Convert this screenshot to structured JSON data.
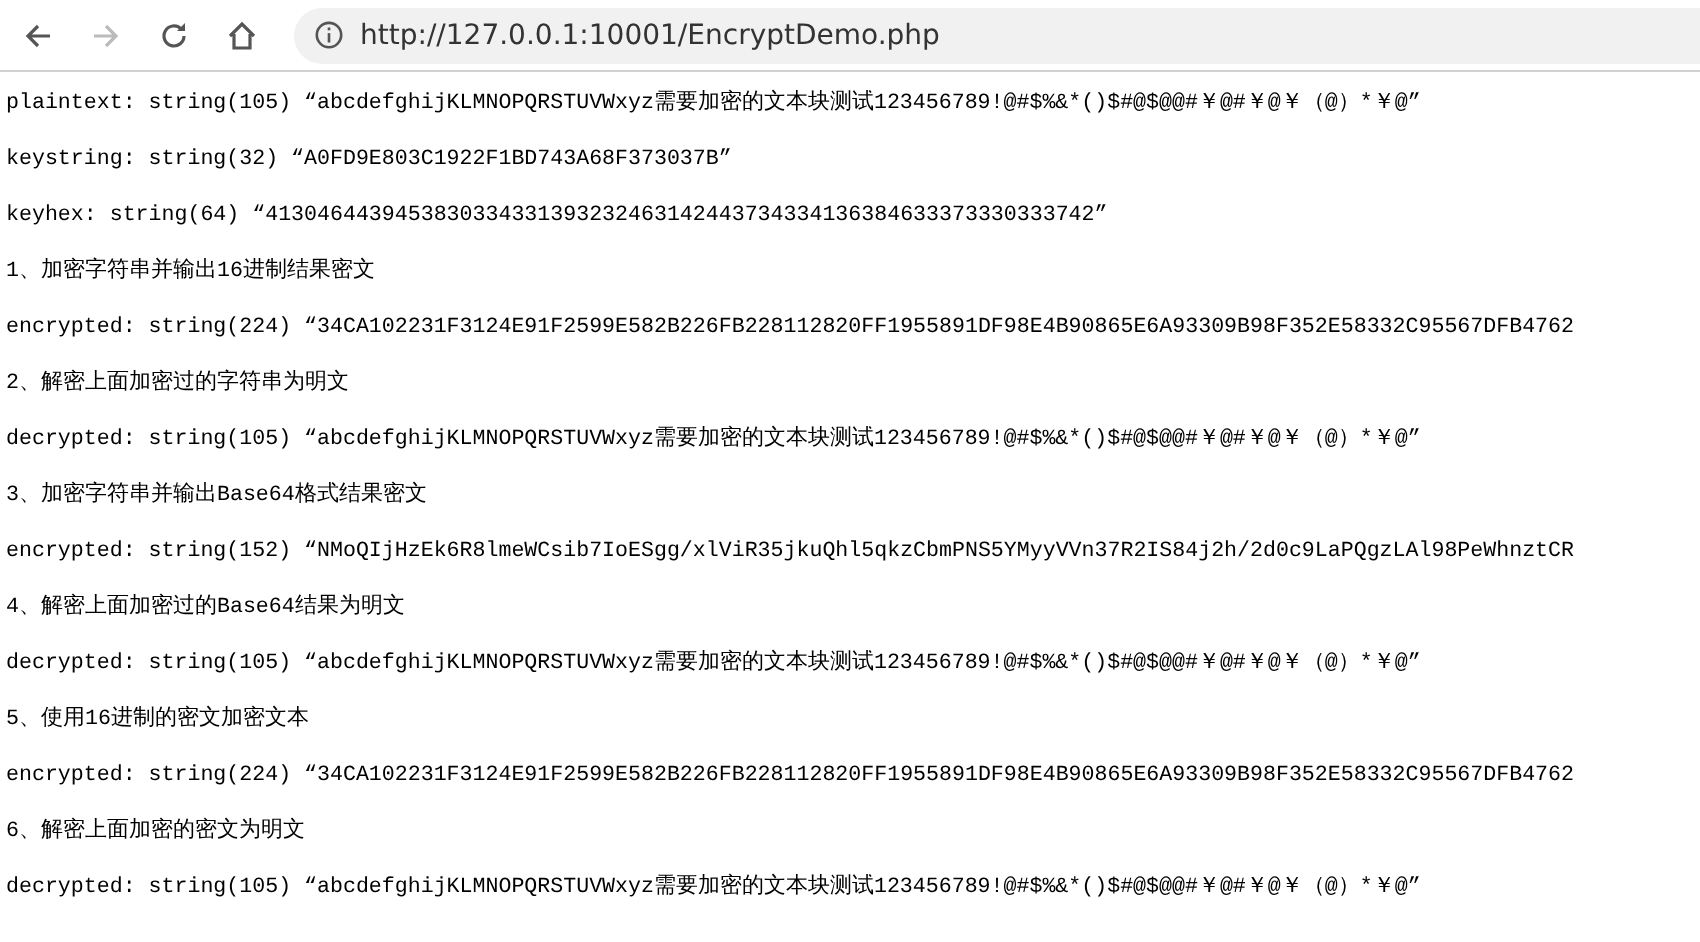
{
  "toolbar": {
    "back_disabled": false,
    "forward_disabled": true,
    "url": "http://127.0.0.1:10001/EncryptDemo.php"
  },
  "lines": [
    "plaintext: string(105) “abcdefghijKLMNOPQRSTUVWxyz需要加密的文本块测试123456789!@#$%&*()$#@$@@#￥@#￥@￥（@）*￥@”",
    "keystring: string(32) “A0FD9E803C1922F1BD743A68F373037B”",
    "keyhex: string(64) “4130464439453830334331393232463142443734334136384633373330333742”",
    "1、加密字符串并输出16进制结果密文",
    "encrypted: string(224) “34CA102231F3124E91F2599E582B226FB228112820FF1955891DF98E4B90865E6A93309B98F352E58332C95567DFB4762",
    "2、解密上面加密过的字符串为明文",
    "decrypted: string(105) “abcdefghijKLMNOPQRSTUVWxyz需要加密的文本块测试123456789!@#$%&*()$#@$@@#￥@#￥@￥（@）*￥@”",
    "3、加密字符串并输出Base64格式结果密文",
    "encrypted: string(152) “NMoQIjHzEk6R8lmeWCsib7IoESgg/xlViR35jkuQhl5qkzCbmPNS5YMyyVVn37R2IS84j2h/2d0c9LaPQgzLAl98PeWhnztCR",
    "4、解密上面加密过的Base64结果为明文",
    "decrypted: string(105) “abcdefghijKLMNOPQRSTUVWxyz需要加密的文本块测试123456789!@#$%&*()$#@$@@#￥@#￥@￥（@）*￥@”",
    "5、使用16进制的密文加密文本",
    "encrypted: string(224) “34CA102231F3124E91F2599E582B226FB228112820FF1955891DF98E4B90865E6A93309B98F352E58332C95567DFB4762",
    "6、解密上面加密的密文为明文",
    "decrypted: string(105) “abcdefghijKLMNOPQRSTUVWxyz需要加密的文本块测试123456789!@#$%&*()$#@$@@#￥@#￥@￥（@）*￥@”"
  ]
}
